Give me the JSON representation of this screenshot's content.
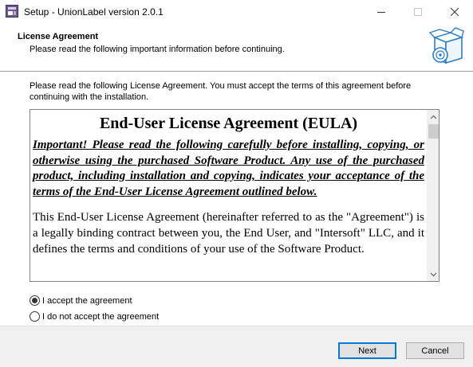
{
  "window": {
    "title": "Setup - UnionLabel version 2.0.1",
    "minimize_icon": "minimize-icon",
    "maximize_icon": "maximize-icon",
    "close_icon": "close-icon"
  },
  "header": {
    "title": "License Agreement",
    "subtitle": "Please read the following important information before continuing.",
    "icon": "setup-box-cd-icon"
  },
  "intro_text": "Please read the following License Agreement. You must accept the terms of this agreement before continuing with the installation.",
  "eula": {
    "heading": "End-User License Agreement (EULA)",
    "important": "Important! Please read the following carefully before installing, copying, or otherwise using the purchased Software Product. Any use of the purchased product, including installation and copying, indicates your acceptance of the terms of the End-User License Agreement outlined below.",
    "paragraph": "This End-User License Agreement (hereinafter referred to as the \"Agreement\") is a legally binding contract between you, the End User, and \"Intersoft\" LLC, and it defines the terms and conditions of your use of the Software Product."
  },
  "options": {
    "accept": {
      "label": "I accept the agreement",
      "checked": true
    },
    "decline": {
      "label": "I do not accept the agreement",
      "checked": false
    }
  },
  "buttons": {
    "next": "Next",
    "cancel": "Cancel"
  },
  "colors": {
    "accent": "#0078d7",
    "footer_bg": "#f0f0f0",
    "scrollbar_bg": "#f0f0f0",
    "scroll_thumb": "#cdcdcd"
  }
}
